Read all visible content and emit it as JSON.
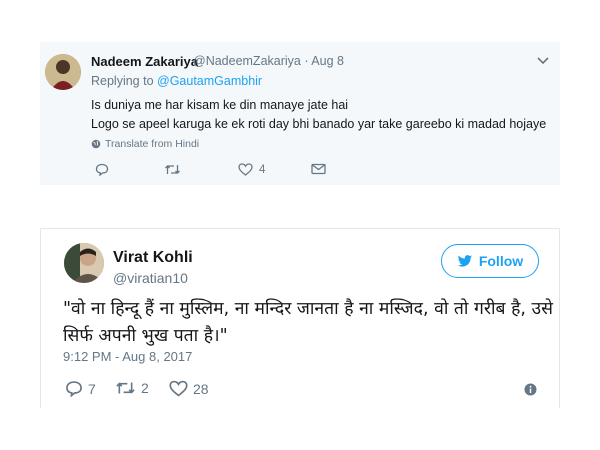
{
  "tweet1": {
    "name": "Nadeem Zakariya",
    "handle_date": "@NadeemZakariya · Aug 8",
    "replying_prefix": "Replying to ",
    "replying_mention": "@GautamGambhir",
    "text_line1": "Is duniya me har kisam ke din manaye jate hai",
    "text_line2": "Logo se apeel karuga ke ek roti day bhi banado yar take gareebo ki madad hojaye",
    "translate": "Translate from Hindi",
    "actions": {
      "reply_count": "",
      "retweet_count": "",
      "like_count": "4"
    }
  },
  "tweet2": {
    "name": "Virat Kohli",
    "handle": "@viratian10",
    "follow_label": "Follow",
    "text": "\"वो ना हिन्दू हैं ना मुस्लिम, ना मन्दिर जानता है ना मस्जिद, वो तो गरीब है, उसे सिर्फ अपनी भुख पता है।\"",
    "timestamp": "9:12 PM - Aug 8, 2017",
    "actions": {
      "reply_count": "7",
      "retweet_count": "2",
      "like_count": "28"
    }
  },
  "colors": {
    "accent": "#1da1f2",
    "secondary_text": "#657786",
    "primary_text": "#14171a",
    "tweet1_background": "#f5f8fa"
  },
  "icons": [
    "chevron-down-icon",
    "globe-icon",
    "reply-icon",
    "retweet-icon",
    "like-icon",
    "message-icon",
    "twitter-bird-icon",
    "info-icon"
  ]
}
